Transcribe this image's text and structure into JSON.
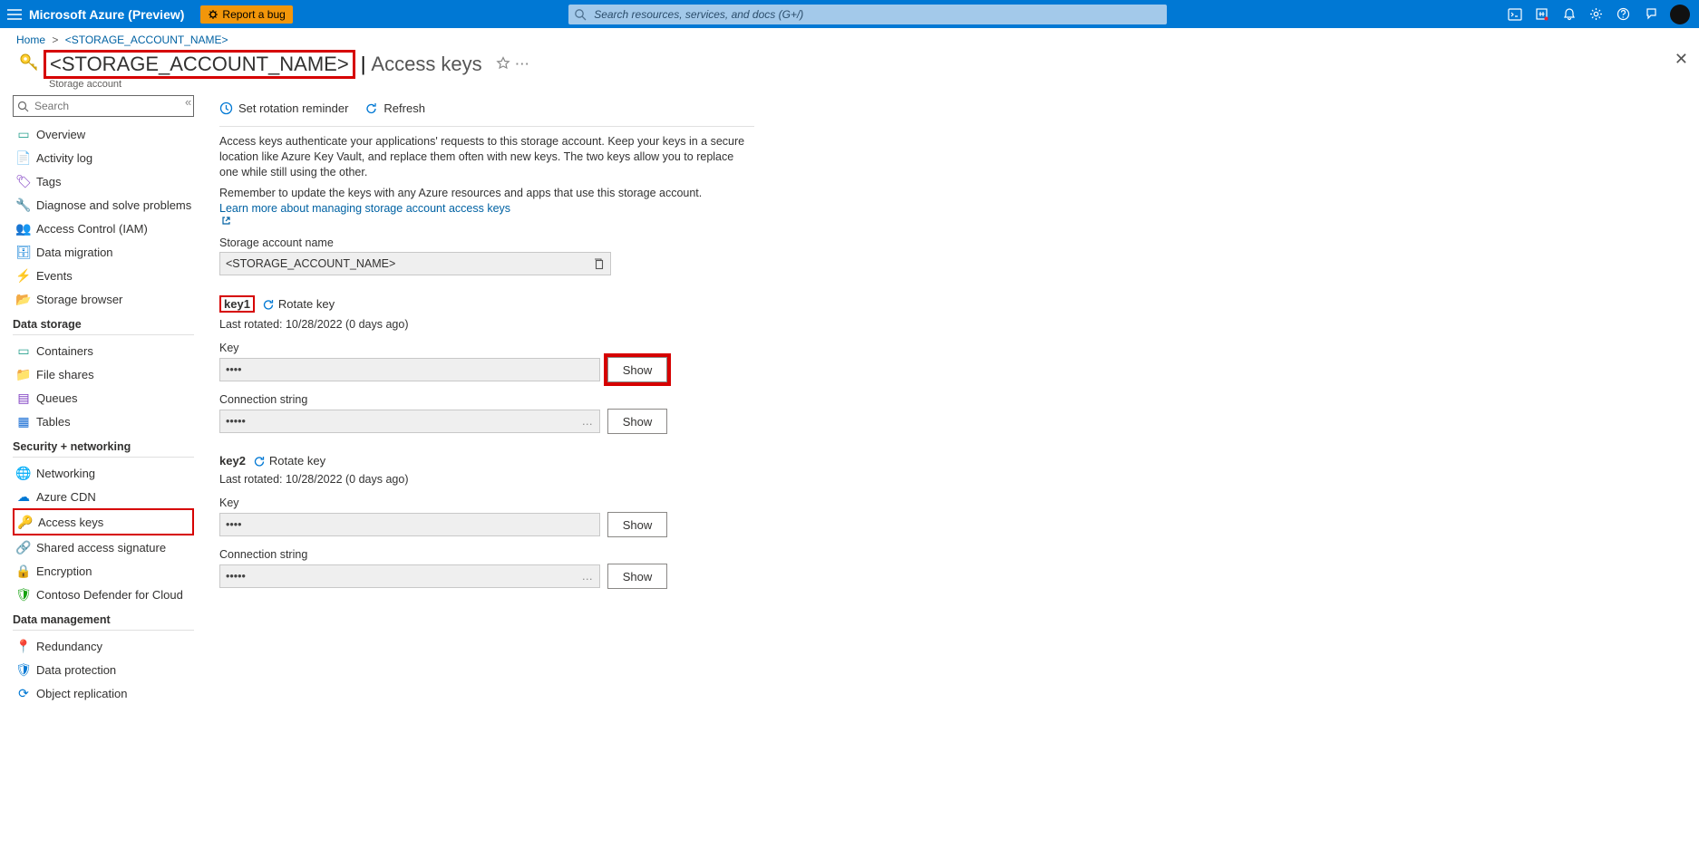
{
  "top": {
    "brand": "Microsoft Azure (Preview)",
    "bug_label": "Report a bug",
    "search_placeholder": "Search resources, services, and docs (G+/)"
  },
  "crumb": {
    "home": "Home",
    "item": "<STORAGE_ACCOUNT_NAME>"
  },
  "title": {
    "account": "<STORAGE_ACCOUNT_NAME>",
    "page": "Access keys",
    "subtitle": "Storage account"
  },
  "sidebar": {
    "search_placeholder": "Search",
    "general": [
      "Overview",
      "Activity log",
      "Tags",
      "Diagnose and solve problems",
      "Access Control (IAM)",
      "Data migration",
      "Events",
      "Storage browser"
    ],
    "data_storage_head": "Data storage",
    "data_storage": [
      "Containers",
      "File shares",
      "Queues",
      "Tables"
    ],
    "security_head": "Security + networking",
    "security": [
      "Networking",
      "Azure CDN",
      "Access keys",
      "Shared access signature",
      "Encryption",
      "Contoso Defender for Cloud"
    ],
    "data_mgmt_head": "Data management",
    "data_mgmt": [
      "Redundancy",
      "Data protection",
      "Object replication"
    ]
  },
  "cmdbar": {
    "set_rotation": "Set rotation reminder",
    "refresh": "Refresh"
  },
  "text": {
    "para1": "Access keys authenticate your applications' requests to this storage account. Keep your keys in a secure location like Azure Key Vault, and replace them often with new keys. The two keys allow you to replace one while still using the other.",
    "para2": "Remember to update the keys with any Azure resources and apps that use this storage account.",
    "learn": "Learn more about managing storage account access keys"
  },
  "fields": {
    "san_label": "Storage account name",
    "san_value": "<STORAGE_ACCOUNT_NAME>",
    "rotate": "Rotate key",
    "key_label": "Key",
    "conn_label": "Connection string",
    "mask4": "••••",
    "mask5": "•••••",
    "show": "Show",
    "key1": {
      "name": "key1",
      "last": "Last rotated: 10/28/2022 (0 days ago)"
    },
    "key2": {
      "name": "key2",
      "last": "Last rotated: 10/28/2022 (0 days ago)"
    }
  }
}
